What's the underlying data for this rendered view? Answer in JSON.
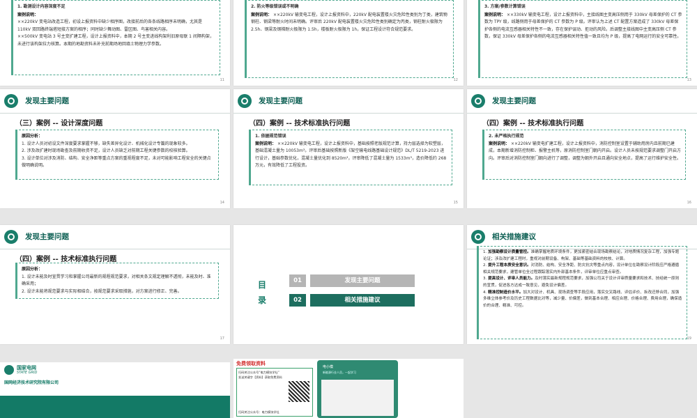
{
  "slides": {
    "s11": {
      "heading": "1. 勘测设计内容深度不足",
      "label": "案例说明：",
      "p1": "××220kV 变电站改造工程，初设上报资料中缺少相序图，改接前后的各条线路相序未明确，尤其是 110kV 双回路终端塔短接方案的相序；同时缺少舞动图、雷区图、鸟害相关内容。",
      "p2": "××500kV 变电站 3 号主变扩建工程，设计上报资料中，本期 2 号主变进线构架利旧原母联 1 间隔构架，未进行该构架拉力核算。本期的地勘资料未补充前期场地回填土物理力学参数。",
      "num": "11"
    },
    "s12": {
      "heading": "2. 防火等级错误或不明确",
      "label": "案例说明：",
      "p1": "××220kV 输变电工程，设计上报资料中，220kV 配电装置楼火灾危险性类别为丁类，建筑物钢柱、钢梁等耐火时间未明确。评审后 220kV 配电装置楼火灾危险性类别确定为丙类，钢柱耐火极限为 2.5h、钢梁及钢梯耐火极限为 1.5h，楼板耐火极限为 1h，保证工程设计符合规范要求。",
      "num": "12"
    },
    "s13": {
      "heading": "3. 方案/参数计算错误",
      "label": "案例说明：",
      "p1": "××330kV 输变电工程，设计上报资料中，主接线图主变高压侧用于 330kV 母差保护的 CT 参数为 TPY 级，线路侧用于母差保护的 CT 参数为 P 级。评审认为上述 CT 配置方案造成了 330kV 母差保护各侧的电流互感器相关特性不一致，存在保护误动、拒动的风险。后调整主接线图中主变高压侧 CT 参数，保证 330kV 母差保护各侧的电流互感器相关特性值一致且均为 P 级，提高了电网运行的安全可靠性。",
      "num": "13"
    },
    "s14": {
      "header": "发现主要问题",
      "title": "（三）案例 -- 设计深度问题",
      "label": "原因分析：",
      "items": [
        "1. 设计人员对初设文件深度要求掌握不够，缺失差异化设计、机械化设计专篇的现象较多。",
        "2. 涉及改扩建时现场勘查及前期收资不足，设计人员缺乏对前期工程关键参数的校核验算。",
        "3. 设计单位对涉及消防、结构、安全净距等重点方案的重视程度不足，未对可能影响工程安全的关键点做明确说明。"
      ],
      "num": "14"
    },
    "s15": {
      "header": "发现主要问题",
      "title": "（四）案例 -- 技术标准执行问题",
      "heading": "1. 依据规范错误",
      "label": "案例说明：",
      "p1": "××220kV 输变电工程，设计上报资料中，基础按照老版规范计算，持力层选择为软塑层，基础混凝土量为 10053m³。评审后基础按照新版《架空输电线路基础设计规范》DL/T 5219-2023 进行设计，基础参数优化，混凝土量优化到 8520m³，评审降低了混凝土量为 1533m³，造价降低约 268 万元，有效降低了工程投资。",
      "num": "15"
    },
    "s16": {
      "header": "发现主要问题",
      "title": "（四）案例 -- 技术标准执行问题",
      "heading": "2. 未严格执行规范",
      "label": "案例说明：",
      "p1": "××220kV 输变电扩建工程，设计上报资料中，消防控制室设置于辅助用房内且前期已建成，本期新增消防控制柜、报警主机等，原消防控制室门朝内开启。设计人员未按规范要求调整门开启方向。评审后对消防控制室门朝向进行了调整，调整为朝外开启且通向安全地点，提高了运行维护安全性。",
      "num": "16"
    },
    "s17": {
      "header": "发现主要问题",
      "title": "（四）案例 -- 技术标准执行问题",
      "label": "原因分析：",
      "items": [
        "1. 设计未能及时宣贯学习和掌握公司最新的规程规范要求，对相关条文规定理解不透彻，未能及时、准确采用；",
        "2. 设计未能将规范要求与实际相结合，按规范要求采取措施，对方案进行修正、完善。"
      ],
      "num": "17"
    },
    "s18": {
      "toc_label": "目 录",
      "items": [
        {
          "num": "01",
          "text": "发现主要问题"
        },
        {
          "num": "02",
          "text": "相关措施建议"
        }
      ]
    },
    "s19": {
      "header": "相关措施建议",
      "items": [
        {
          "head": "加强勘察设计质量管控。",
          "body": "准确掌握地质环境条件，更加紧密结合现场勘察结论，对地质情况复杂工程，加强专题论证；涉及改扩建工程时，重视对前期设备、构架、基础等基础资料的校核、计算。"
        },
        {
          "head": "提升工程本质安全意识。",
          "body": "对消防、结构、安全净距、防灾抗灾等重点内容，设计单位在勘察设计阶段应严格遵循相关规范要求，建管单位全过程跟踪落实内外部基本条件，评审单位应重点审查。"
        },
        {
          "head": "提高设计、评审人员能力。",
          "body": "及时落实最新规程规范要求，加强公司关于设计评审质量要求和技术、技经统一原则的宣贯，促进各方达成一致意见，避免设计偏差。"
        },
        {
          "head": "精准控制造价水平。",
          "body": "加大对设计、机具、现场调查等手段应用，落实交叉路线、评估评价、拆改迁移合同，加强多维立体参考价及历史工程数据比对等，减少量、价偏差，做到基本合理、相应合理、价格合理、费用合理，确保造价的合理、精准、可控。"
        }
      ],
      "num": "19"
    },
    "brand": {
      "cn": "国家电网",
      "en": "STATE GRID",
      "institute": "国网经济技术研究院有限公司"
    },
    "promo": {
      "title": "免费领取资料",
      "line1": "扫码关注公众号“电力模块学社”",
      "line2": "发送关键字【资料】获取免费资料",
      "qr_caption": "扫码关注公众号：电力模块学社",
      "phone_title": "电小模",
      "phone_sub": "新能源行业人员，一起学习"
    }
  },
  "colors": {
    "accent": "#1a7e6b",
    "dashed": "#4fa88f",
    "tocGrey": "#b5b5b5",
    "tocGreen": "#1d6e5f"
  }
}
